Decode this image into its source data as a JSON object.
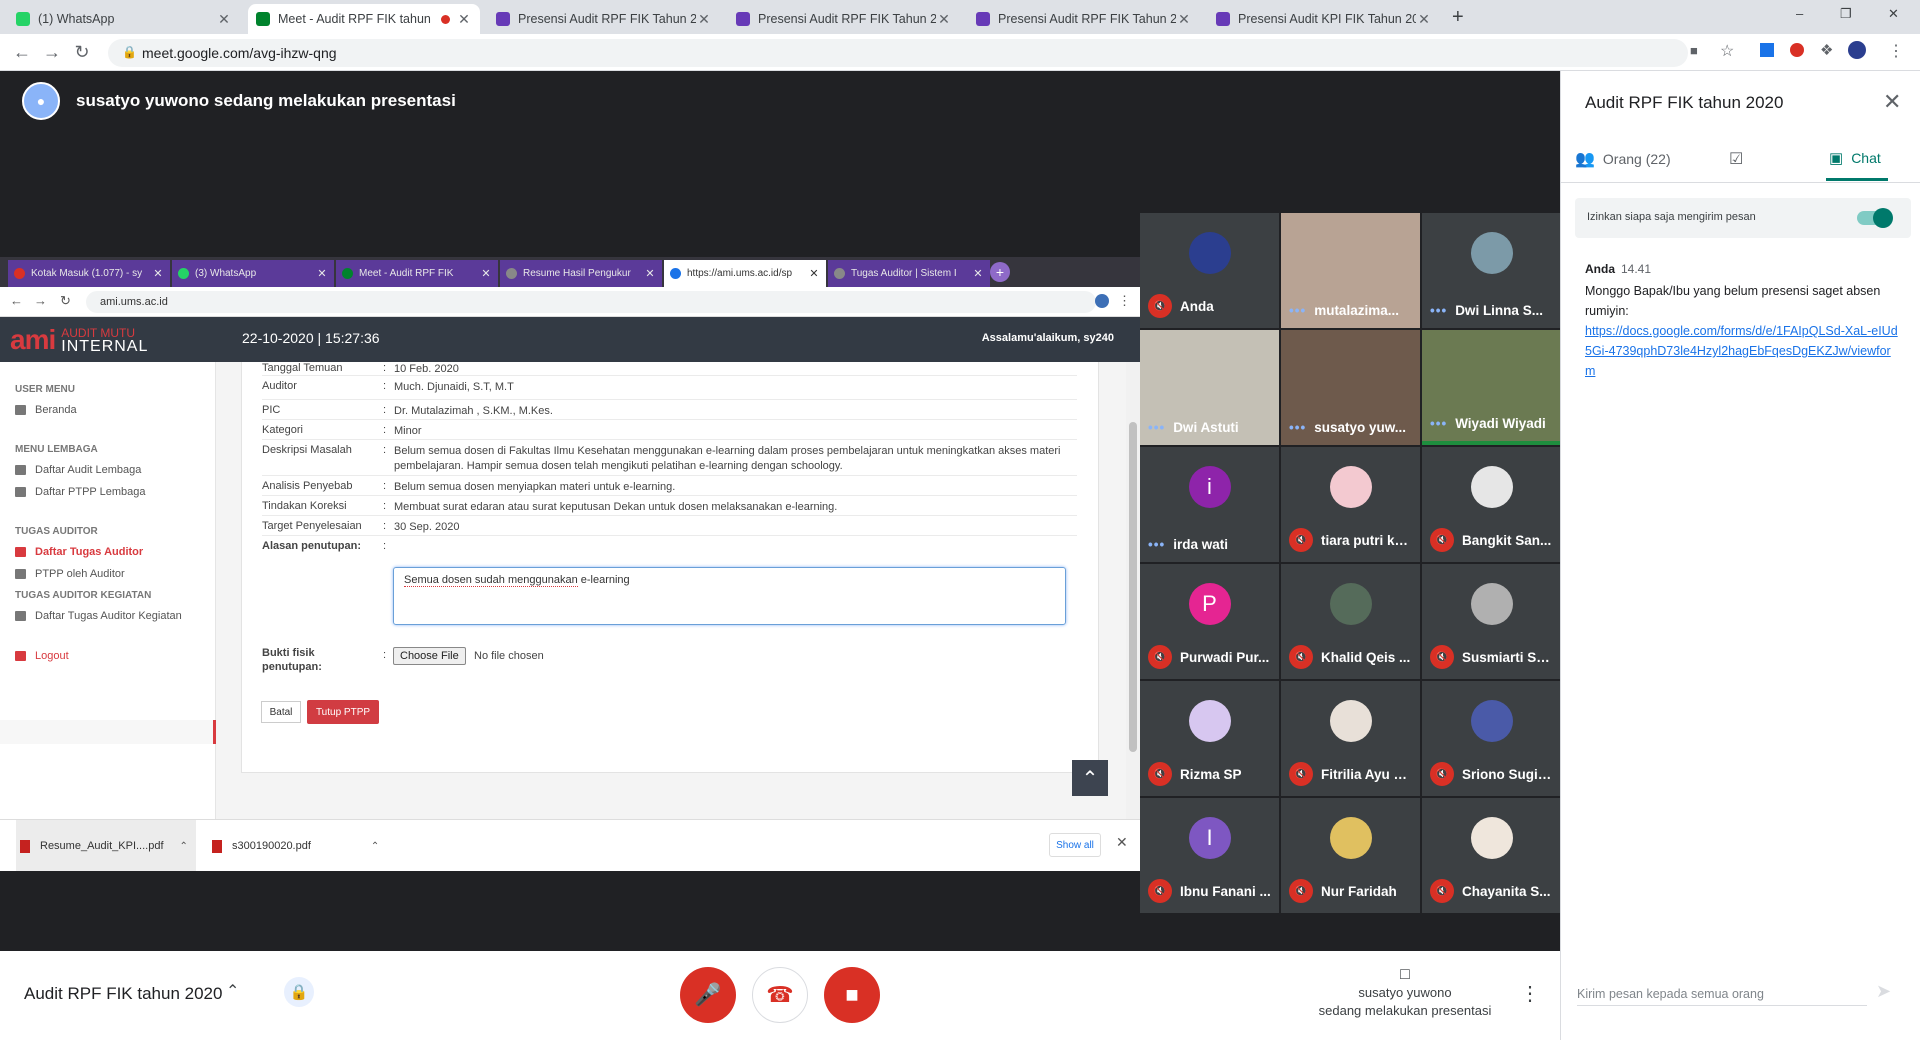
{
  "browser": {
    "tabs": [
      {
        "label": "(1) WhatsApp",
        "color": "#25d366",
        "active": false
      },
      {
        "label": "Meet - Audit RPF FIK tahun 2",
        "color": "#00832d",
        "active": true,
        "recording": true
      },
      {
        "label": "Presensi Audit RPF FIK Tahun 202",
        "color": "#673ab7",
        "active": false
      },
      {
        "label": "Presensi Audit RPF FIK Tahun 202",
        "color": "#673ab7",
        "active": false
      },
      {
        "label": "Presensi Audit RPF FIK Tahun 202",
        "color": "#673ab7",
        "active": false
      },
      {
        "label": "Presensi Audit KPI FIK Tahun 202",
        "color": "#673ab7",
        "active": false
      }
    ],
    "url": "meet.google.com/avg-ihzw-qng"
  },
  "meet": {
    "presenter_banner": "susatyo yuwono sedang melakukan presentasi",
    "meeting_name": "Audit RPF FIK tahun 2020",
    "presenting_line1": "susatyo yuwono",
    "presenting_line2": "sedang melakukan presentasi"
  },
  "shared": {
    "tabs": [
      {
        "label": "Kotak Masuk (1.077) - sy",
        "color": "#d93025"
      },
      {
        "label": "(3) WhatsApp",
        "color": "#25d366"
      },
      {
        "label": "Meet - Audit RPF FIK",
        "color": "#00832d"
      },
      {
        "label": "Resume Hasil Pengukur",
        "color": "#888888"
      },
      {
        "label": "https://ami.ums.ac.id/sp",
        "color": "#1a73e8"
      },
      {
        "label": "Tugas Auditor | Sistem I",
        "color": "#888888"
      }
    ],
    "url": "ami.ums.ac.id",
    "logo_ami": "ami",
    "logo_line1": "AUDIT MUTU",
    "logo_line2": "INTERNAL",
    "datetime": "22-10-2020 | 15:27:36",
    "greeting": "Assalamu'alaikum, sy240",
    "menu": {
      "user_menu": "USER MENU",
      "beranda": "Beranda",
      "menu_lembaga": "MENU LEMBAGA",
      "daftar_audit": "Daftar Audit Lembaga",
      "daftar_ptpp": "Daftar PTPP Lembaga",
      "tugas_auditor": "TUGAS AUDITOR",
      "daftar_tugas": "Daftar Tugas Auditor",
      "ptpp_oleh": "PTPP oleh Auditor",
      "tugas_kegiatan": "TUGAS AUDITOR KEGIATAN",
      "daftar_kegiatan": "Daftar Tugas Auditor Kegiatan",
      "logout": "Logout"
    },
    "form": {
      "rows": [
        {
          "label": "Tanggal Temuan",
          "value": "10 Feb. 2020"
        },
        {
          "label": "Auditor",
          "value": "Much. Djunaidi, S.T, M.T"
        },
        {
          "label": "PIC",
          "value": "Dr. Mutalazimah , S.KM., M.Kes."
        },
        {
          "label": "Kategori",
          "value": "Minor"
        },
        {
          "label": "Deskripsi Masalah",
          "value": "Belum semua dosen di Fakultas Ilmu Kesehatan menggunakan e-learning dalam proses pembelajaran untuk meningkatkan akses materi pembelajaran. Hampir semua dosen telah mengikuti pelatihan e-learning dengan schoology."
        },
        {
          "label": "Analisis Penyebab",
          "value": "Belum semua dosen menyiapkan materi untuk e-learning."
        },
        {
          "label": "Tindakan Koreksi",
          "value": "Membuat surat edaran atau surat keputusan Dekan untuk dosen melaksanakan e-learning."
        },
        {
          "label": "Target Penyelesaian",
          "value": "30 Sep. 2020"
        }
      ],
      "colon": ":",
      "alasan_label": "Alasan penutupan:",
      "alasan_value": "Semua dosen sudah menggunakan e-learning",
      "alasan_underlined": "Semua dosen sudah menggunakan",
      "alasan_rest": " e-learning",
      "bukti_label": "Bukti fisik penutupan:",
      "choose_file": "Choose File",
      "no_file": "No file chosen",
      "batal": "Batal",
      "tutup": "Tutup PTPP"
    },
    "downloads": {
      "items": [
        "Resume_Audit_KPI....pdf",
        "s300190020.pdf"
      ],
      "show_all": "Show all"
    }
  },
  "participants": [
    {
      "name": "Anda",
      "state": "muted",
      "kind": "logo",
      "color": "#2b3e8f"
    },
    {
      "name": "mutalazima...",
      "state": "dots",
      "kind": "video",
      "color": "#b8a394"
    },
    {
      "name": "Dwi Linna S...",
      "state": "dots",
      "kind": "photo",
      "color": "#7c9aa8"
    },
    {
      "name": "Dwi Astuti",
      "state": "dots",
      "kind": "video",
      "color": "#c4c0b5"
    },
    {
      "name": "susatyo yuw...",
      "state": "dots",
      "kind": "video",
      "color": "#6e5a4c"
    },
    {
      "name": "Wiyadi Wiyadi",
      "state": "dots",
      "kind": "video",
      "color": "#6b7a52",
      "speaking": true
    },
    {
      "name": "irda wati",
      "state": "dots",
      "kind": "letter",
      "letter": "i",
      "color": "#8e24aa"
    },
    {
      "name": "tiara putri ku...",
      "state": "muted",
      "kind": "photo",
      "color": "#f3c9d0"
    },
    {
      "name": "Bangkit San...",
      "state": "muted",
      "kind": "photo",
      "color": "#e6e6e6"
    },
    {
      "name": "Purwadi Pur...",
      "state": "muted",
      "kind": "letter",
      "letter": "P",
      "color": "#e52592"
    },
    {
      "name": "Khalid Qeis ...",
      "state": "muted",
      "kind": "photo",
      "color": "#556b5a"
    },
    {
      "name": "Susmiarti Su...",
      "state": "muted",
      "kind": "photo",
      "color": "#b0b0b0"
    },
    {
      "name": "Rizma SP",
      "state": "muted",
      "kind": "photo",
      "color": "#d7c7f0"
    },
    {
      "name": "Fitrilia Ayu N...",
      "state": "muted",
      "kind": "photo",
      "color": "#e8e0d8"
    },
    {
      "name": "Sriono Sugia...",
      "state": "muted",
      "kind": "photo",
      "color": "#4a5aa8"
    },
    {
      "name": "Ibnu Fanani ...",
      "state": "muted",
      "kind": "letter",
      "letter": "I",
      "color": "#7e57c2"
    },
    {
      "name": "Nur Faridah",
      "state": "muted",
      "kind": "photo",
      "color": "#e0c060"
    },
    {
      "name": "Chayanita S...",
      "state": "muted",
      "kind": "photo",
      "color": "#efe6dc"
    }
  ],
  "panel": {
    "title": "Audit RPF FIK tahun 2020",
    "people_tab": "Orang (22)",
    "chat_tab": "Chat",
    "allow_text": "Izinkan siapa saja mengirim pesan",
    "msg_sender": "Anda",
    "msg_time": "14.41",
    "msg_text": "Monggo Bapak/Ibu yang belum presensi saget absen rumiyin:",
    "msg_link": "https://docs.google.com/forms/d/e/1FAIpQLSd-XaL-eIUd5Gi-4739qphD73le4Hzyl2hagEbFqesDgEKZJw/viewform",
    "input_placeholder": "Kirim pesan kepada semua orang"
  }
}
